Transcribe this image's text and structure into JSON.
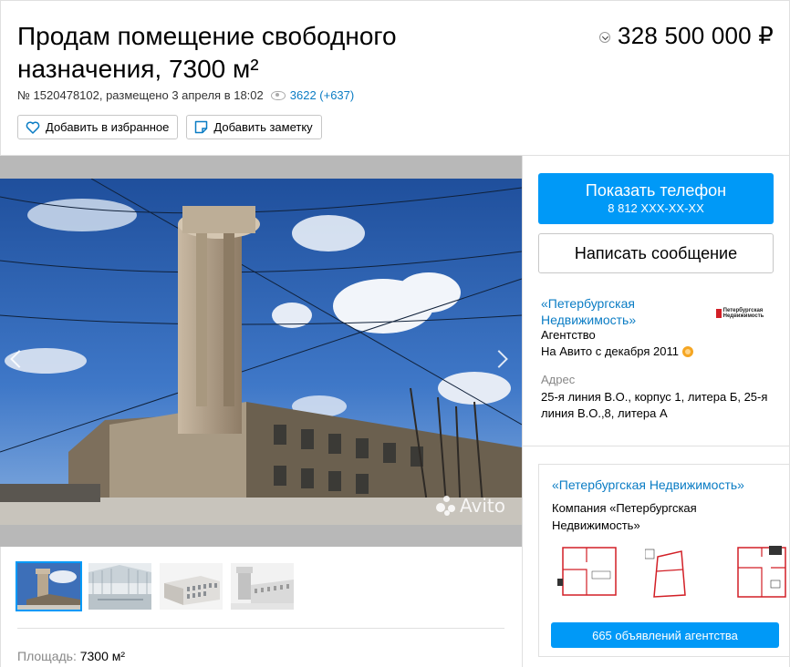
{
  "listing": {
    "title": "Продам помещение свободного назначения, 7300 м²",
    "price": "328 500 000 ₽",
    "number_line": "№ 1520478102, размещено 3 апреля в 18:02",
    "views": "3622 (+637)"
  },
  "actions": {
    "favorite_label": "Добавить в избранное",
    "note_label": "Добавить заметку"
  },
  "gallery": {
    "watermark": "Avito",
    "thumbnails": [
      "water-tower-photo",
      "hall-render",
      "building-render",
      "tower-facade-photo"
    ]
  },
  "params": {
    "area_label": "Площадь:",
    "area_value": "7300 м²"
  },
  "contact": {
    "phone_button": "Показать телефон",
    "phone_masked": "8 812 XXX-XX-XX",
    "message_button": "Написать сообщение"
  },
  "seller": {
    "name": "«Петербургская Недвижимость»",
    "logo_text": "Петербургская Недвижимость",
    "type": "Агентство",
    "since": "На Авито с декабря 2011",
    "address_label": "Адрес",
    "address": "25-я линия В.О., корпус 1, литера Б, 25-я линия В.О.,8, литера А"
  },
  "agency": {
    "title": "«Петербургская Недвижимость»",
    "description": "Компания «Петербургская Недвижимость»",
    "listings_button": "665 объявлений агентства"
  },
  "colors": {
    "accent": "#0099f7",
    "link": "#0a7cc4",
    "plan_red": "#d21f26"
  }
}
